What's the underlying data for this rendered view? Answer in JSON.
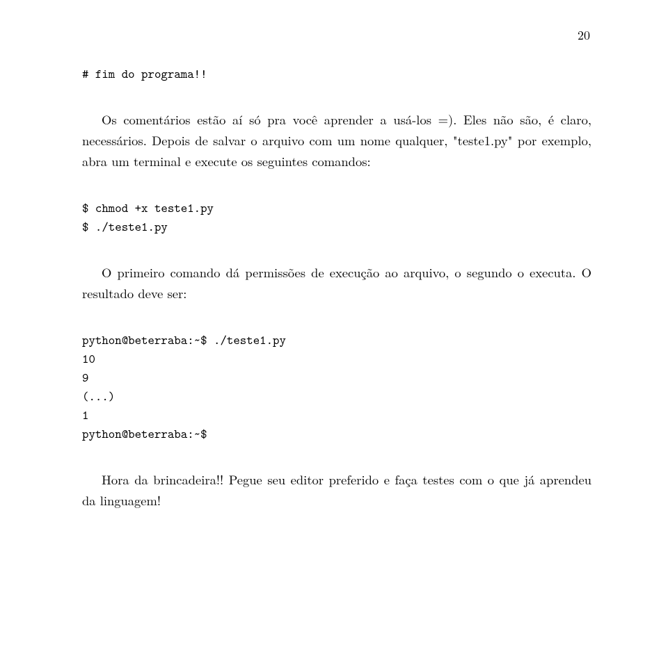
{
  "page_number": "20",
  "code1": "# fim do programa!!",
  "para1": "Os comentários estão aí só pra você aprender a usá-los =). Eles não são, é claro, necessários. Depois de salvar o arquivo com um nome qualquer, \"teste1.py\" por exemplo, abra um terminal e execute os seguintes comandos:",
  "code2_line1": "$ chmod +x teste1.py",
  "code2_line2": "$ ./teste1.py",
  "para2": "O primeiro comando dá permissões de execução ao arquivo, o segundo o executa. O resultado deve ser:",
  "code3_line1": "python@beterraba:~$ ./teste1.py",
  "code3_line2": "10",
  "code3_line3": "9",
  "code3_line4": "(...)",
  "code3_line5": "1",
  "code3_line6": "python@beterraba:~$",
  "para3": "Hora da brincadeira!! Pegue seu editor preferido e faça testes com o que já aprendeu da linguagem!"
}
